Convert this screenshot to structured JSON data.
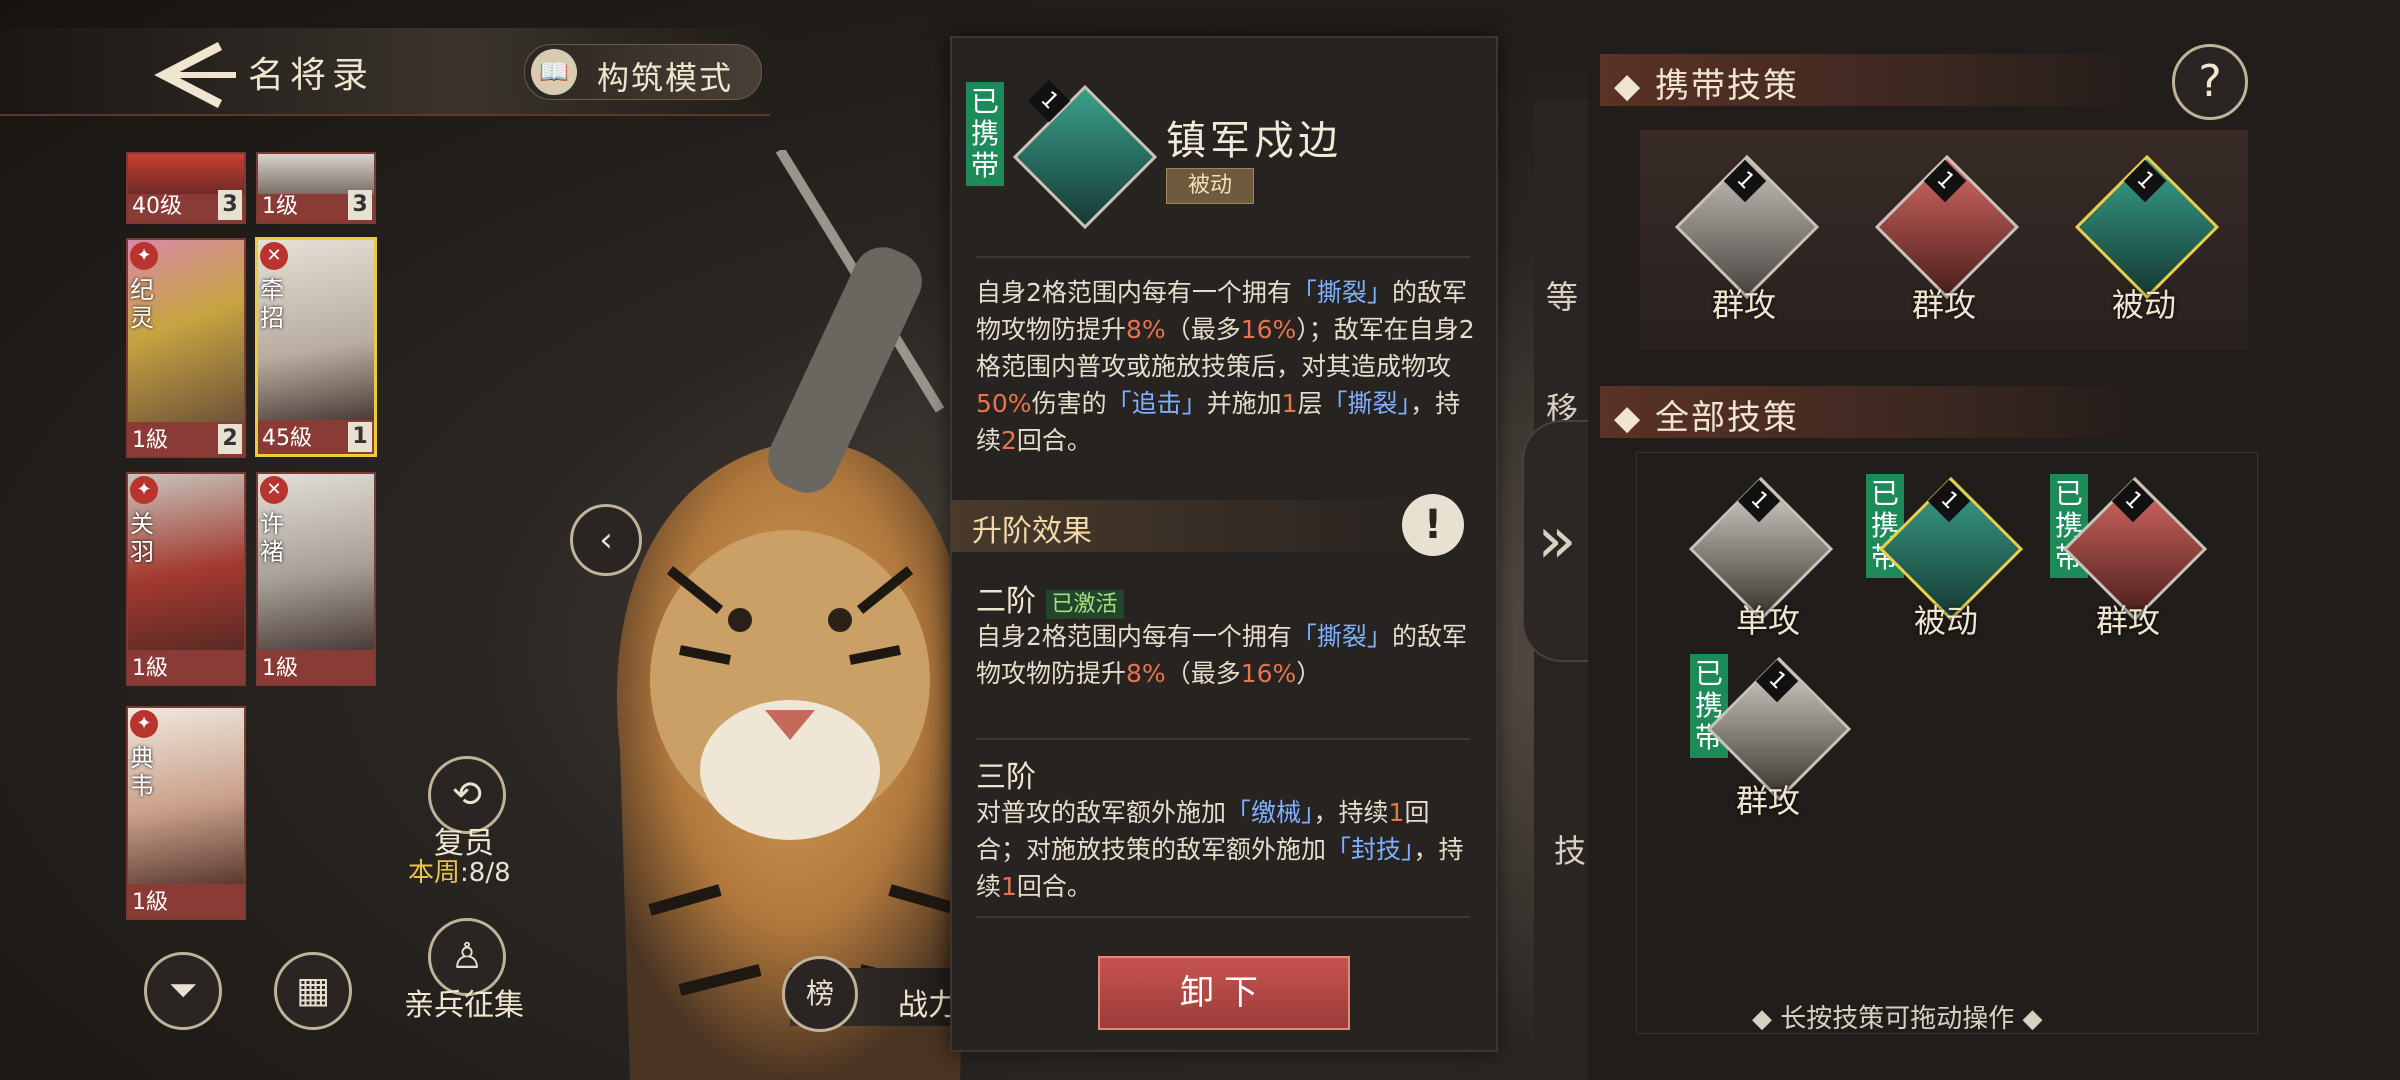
{
  "header": {
    "title": "名将录",
    "build_mode": "构筑模式"
  },
  "heroes": [
    {
      "name": "",
      "level": "40级",
      "count": "3"
    },
    {
      "name": "",
      "level": "1级",
      "count": "3"
    },
    {
      "name": "纪灵",
      "level": "1級",
      "count": "2"
    },
    {
      "name": "牵招",
      "level": "45級",
      "count": "1"
    },
    {
      "name": "关羽",
      "level": "1級",
      "count": ""
    },
    {
      "name": "许褚",
      "level": "1級",
      "count": ""
    },
    {
      "name": "典韦",
      "level": "1級",
      "count": ""
    }
  ],
  "left_buttons": {
    "revive": "复员",
    "week_label": "本周",
    "week_value": ":8/8",
    "recruit": "亲兵征集",
    "power_label": "战力",
    "rank_icon_text": "榜"
  },
  "detail": {
    "equipped": "已携带",
    "icon_level": "1",
    "name": "镇军戍边",
    "type": "被动",
    "desc": {
      "p1": "自身2格范围内每有一个拥有",
      "k1": "「撕裂」",
      "p2": "的敌军物攻物防提升",
      "v1": "8%",
      "p3": "（最多",
      "v2": "16%",
      "p4": "）；敌军在自身2格范围内普攻或施放技策后，对其造成物攻",
      "v3": "50%",
      "p5": "伤害的",
      "k2": "「追击」",
      "p6": "并施加",
      "v4": "1",
      "p7": "层",
      "k3": "「撕裂」",
      "p8": "，持续",
      "v5": "2",
      "p9": "回合。"
    },
    "upgrade_label": "升阶效果",
    "tier2": {
      "title": "二阶",
      "badge": "已激活",
      "p1": "自身2格范围内每有一个拥有",
      "k1": "「撕裂」",
      "p2": "的敌军物攻物防提升",
      "v1": "8%",
      "p3": "（最多",
      "v2": "16%",
      "p4": "）"
    },
    "tier3": {
      "title": "三阶",
      "p1": "对普攻的敌军额外施加",
      "k1": "「缴械」",
      "p2": "，持续",
      "v1": "1",
      "p3": "回合；对施放技策的敌军额外施加",
      "k2": "「封技」",
      "p4": "，持续",
      "v2": "1",
      "p5": "回合。"
    },
    "unload": "卸下"
  },
  "right": {
    "carried_title": "携带技策",
    "carried": [
      {
        "label": "群攻",
        "level": "1"
      },
      {
        "label": "群攻",
        "level": "1"
      },
      {
        "label": "被动",
        "level": "1"
      }
    ],
    "all_title": "全部技策",
    "all": [
      {
        "label": "单攻",
        "level": "1",
        "equipped": ""
      },
      {
        "label": "被动",
        "level": "1",
        "equipped": "已携带"
      },
      {
        "label": "群攻",
        "level": "1",
        "equipped": "已携带"
      },
      {
        "label": "群攻",
        "level": "1",
        "equipped": "已携带"
      }
    ],
    "hint": "长按技策可拖动操作",
    "side_labels": [
      "等",
      "移",
      "技"
    ]
  },
  "colors": {
    "accent_gold": "#e8d04c",
    "equipped_green": "#1d8a5a",
    "keyword_blue": "#7fb0ff",
    "value_red": "#e8734c",
    "button_red": "#c65350"
  }
}
